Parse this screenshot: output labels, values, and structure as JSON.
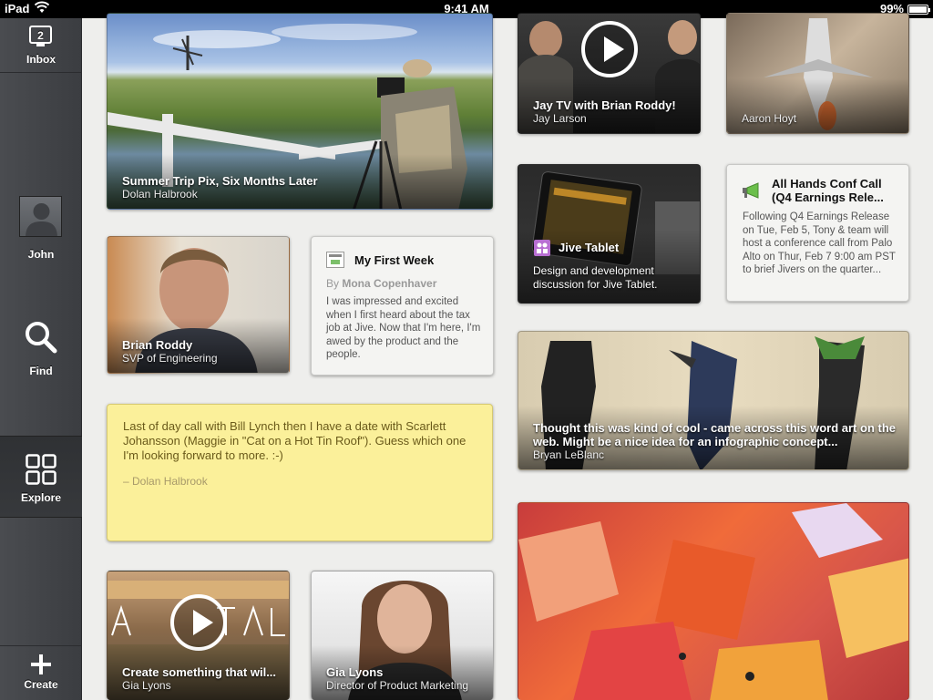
{
  "status_bar": {
    "carrier": "iPad",
    "time": "9:41 AM",
    "battery": "99%",
    "battery_level": 0.99
  },
  "sidebar": {
    "inbox": {
      "label": "Inbox",
      "count": "2"
    },
    "profile": {
      "label": "John"
    },
    "find": {
      "label": "Find"
    },
    "explore": {
      "label": "Explore"
    },
    "create": {
      "label": "Create"
    }
  },
  "cards": {
    "summer": {
      "title": "Summer Trip Pix, Six Months Later",
      "author": "Dolan Halbrook"
    },
    "jaytv": {
      "title": "Jay TV with Brian Roddy!",
      "author": "Jay Larson"
    },
    "aaron": {
      "author": "Aaron Hoyt"
    },
    "brian": {
      "name": "Brian Roddy",
      "role": "SVP of Engineering"
    },
    "firstweek": {
      "title": "My First Week",
      "by": "By",
      "author": "Mona Copenhaver",
      "body": "I was impressed and excited when I first heard about the tax job at Jive.  Now that I'm here, I'm awed by the product and the people."
    },
    "jivetablet": {
      "title": "Jive Tablet",
      "desc": "Design and development discussion for Jive Tablet."
    },
    "allhands": {
      "title": "All Hands Conf Call (Q4 Earnings Rele...",
      "body": "Following Q4 Earnings Release on Tue, Feb 5, Tony & team will host a conference call from Palo Alto on Thur, Feb 7 9:00 am PST to brief Jivers on the quarter..."
    },
    "note": {
      "body": "Last of day call with Bill Lynch then I have a date with Scarlett Johansson (Maggie in \"Cat on a Hot Tin Roof\").  Guess which one I'm looking forward to more.  :-)",
      "author": "– Dolan Halbrook"
    },
    "wordart": {
      "text": "Thought this was kind of cool - came across this word art on the web.  Might be a nice idea for an infographic concept...",
      "author": "Bryan LeBlanc"
    },
    "create": {
      "title": "Create something that wil...",
      "author": "Gia Lyons"
    },
    "gia": {
      "name": "Gia Lyons",
      "role": "Director of Product Marketing"
    }
  }
}
